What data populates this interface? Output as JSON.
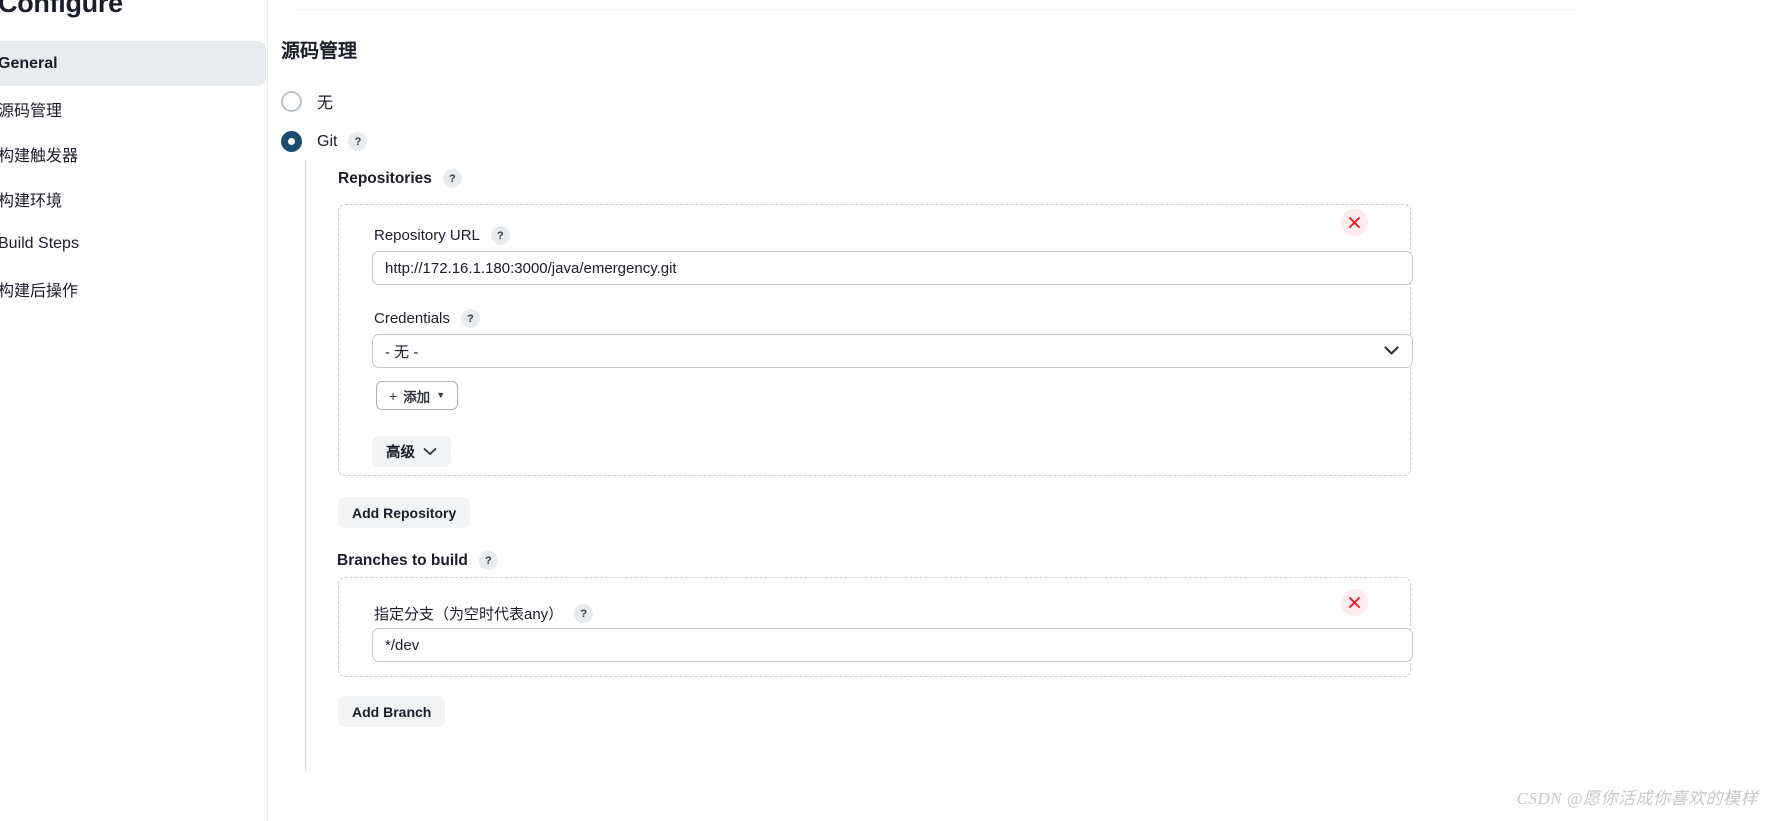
{
  "page": {
    "title": "Configure",
    "watermark": "CSDN @愿你活成你喜欢的模样"
  },
  "sidebar": {
    "items": [
      {
        "label": "General",
        "active": true
      },
      {
        "label": "源码管理",
        "active": false
      },
      {
        "label": "构建触发器",
        "active": false
      },
      {
        "label": "构建环境",
        "active": false
      },
      {
        "label": "Build Steps",
        "active": false
      },
      {
        "label": "构建后操作",
        "active": false
      }
    ]
  },
  "main": {
    "section_title": "源码管理",
    "scm_options": [
      {
        "label": "无",
        "selected": false
      },
      {
        "label": "Git",
        "selected": true,
        "help": "?"
      }
    ],
    "repositories": {
      "label": "Repositories",
      "help": "?",
      "repo_url": {
        "label": "Repository URL",
        "help": "?",
        "value": "http://172.16.1.180:3000/java/emergency.git",
        "placeholder": ""
      },
      "credentials": {
        "label": "Credentials",
        "help": "?",
        "selected": "- 无 -",
        "options": [
          "- 无 -"
        ]
      },
      "add_credentials_button": "添加",
      "add_credentials_plus": "+",
      "advanced_button": "高级",
      "delete_icon": "×"
    },
    "add_repository_button": "Add Repository",
    "branches": {
      "label": "Branches to build",
      "help": "?",
      "branch_spec": {
        "label": "指定分支（为空时代表any）",
        "help": "?",
        "value": "*/dev",
        "placeholder": ""
      },
      "delete_icon": "×"
    },
    "add_branch_button": "Add Branch"
  },
  "colors": {
    "accent": "#1b4c6e",
    "danger": "#e8192c",
    "danger_bg": "#fdebee",
    "border": "#c3ccd4",
    "soft_bg": "#f1f3f5",
    "active_nav_bg": "#e9ecef"
  }
}
